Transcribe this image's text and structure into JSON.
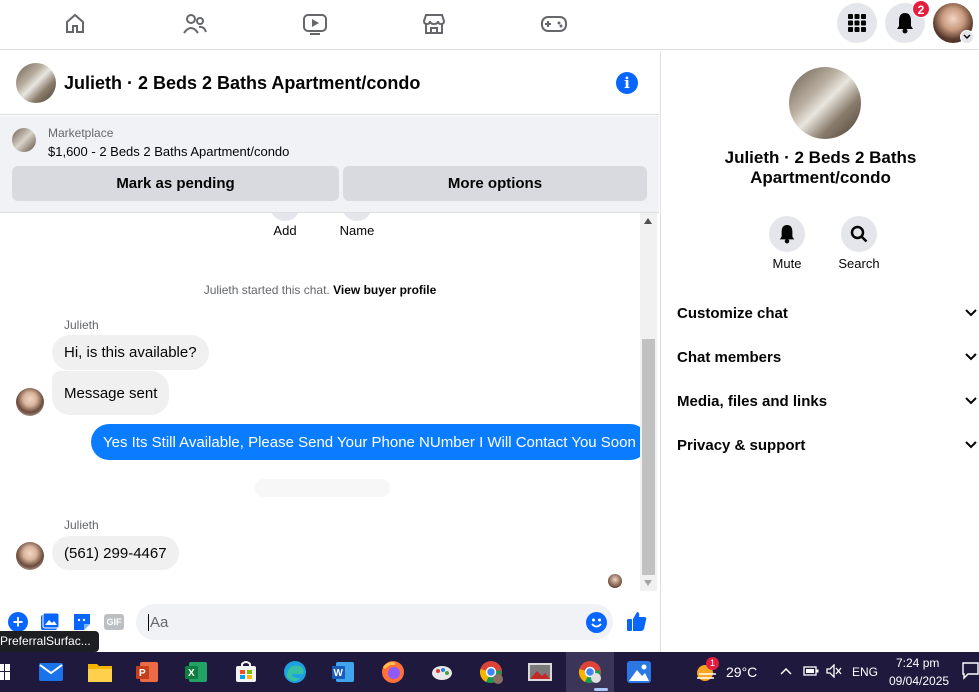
{
  "topnav": {
    "icons": [
      "home-icon",
      "friends-icon",
      "video-icon",
      "marketplace-icon",
      "gaming-icon"
    ],
    "notifications_count": "2",
    "colors": {
      "accent": "#0866ff",
      "badge": "#e41e3f"
    }
  },
  "chat": {
    "title": "Julieth · 2 Beds 2 Baths Apartment/condo",
    "marketplace_label": "Marketplace",
    "listing": "$1,600 - 2 Beds 2 Baths Apartment/condo",
    "mark_pending": "Mark as pending",
    "more_options": "More options",
    "partial_actions": [
      "Add",
      "Name"
    ],
    "system_prefix": "Julieth started this chat.",
    "system_link": "View buyer profile",
    "messages": [
      {
        "sender": "Julieth",
        "text": "Hi, is this available?"
      },
      {
        "text": "Message sent"
      },
      {
        "text": "Yes Its Still Available, Please Send Your Phone NUmber I Will Contact You Soon",
        "outgoing": true
      },
      {
        "sender": "Julieth",
        "text": "(561) 299-4467"
      }
    ],
    "input_placeholder": "Aa"
  },
  "rightpane": {
    "name_line1": "Julieth · 2 Beds 2 Baths",
    "name_line2": "Apartment/condo",
    "mute": "Mute",
    "search": "Search",
    "sections": [
      "Customize chat",
      "Chat members",
      "Media, files and links",
      "Privacy & support"
    ]
  },
  "tooltip": "PreferralSurfac...",
  "taskbar": {
    "weather_badge": "1",
    "temperature": "29°C",
    "language": "ENG",
    "time": "7:24 pm",
    "date": "09/04/2025"
  }
}
